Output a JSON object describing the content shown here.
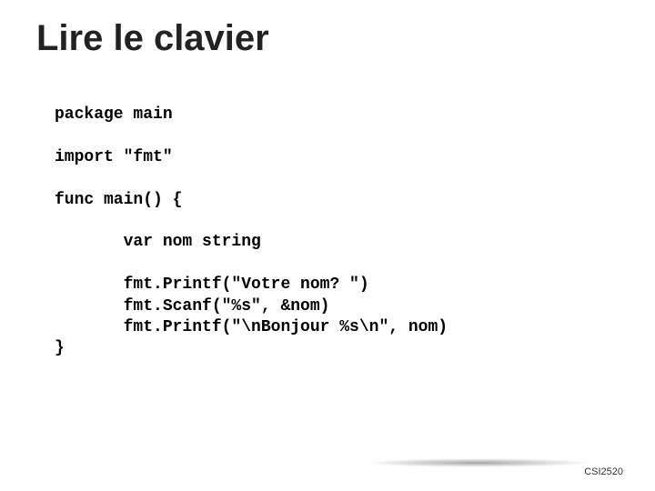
{
  "title": "Lire le clavier",
  "code": "package main\n\nimport \"fmt\"\n\nfunc main() {\n\n       var nom string\n\n       fmt.Printf(\"Votre nom? \")\n       fmt.Scanf(\"%s\", &nom)\n       fmt.Printf(\"\\nBonjour %s\\n\", nom)\n}",
  "footer": "CSI2520"
}
